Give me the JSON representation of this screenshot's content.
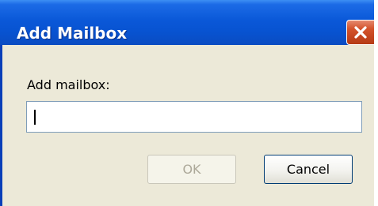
{
  "dialog": {
    "title": "Add Mailbox",
    "close_icon": "close-x-icon"
  },
  "form": {
    "label": "Add mailbox:",
    "input_value": "",
    "input_placeholder": ""
  },
  "buttons": {
    "ok_label": "OK",
    "ok_enabled": false,
    "cancel_label": "Cancel"
  },
  "colors": {
    "titlebar": "#0853d1",
    "close_button": "#d4542c",
    "dialog_background": "#ece9d8",
    "disabled_text": "#aca899"
  }
}
